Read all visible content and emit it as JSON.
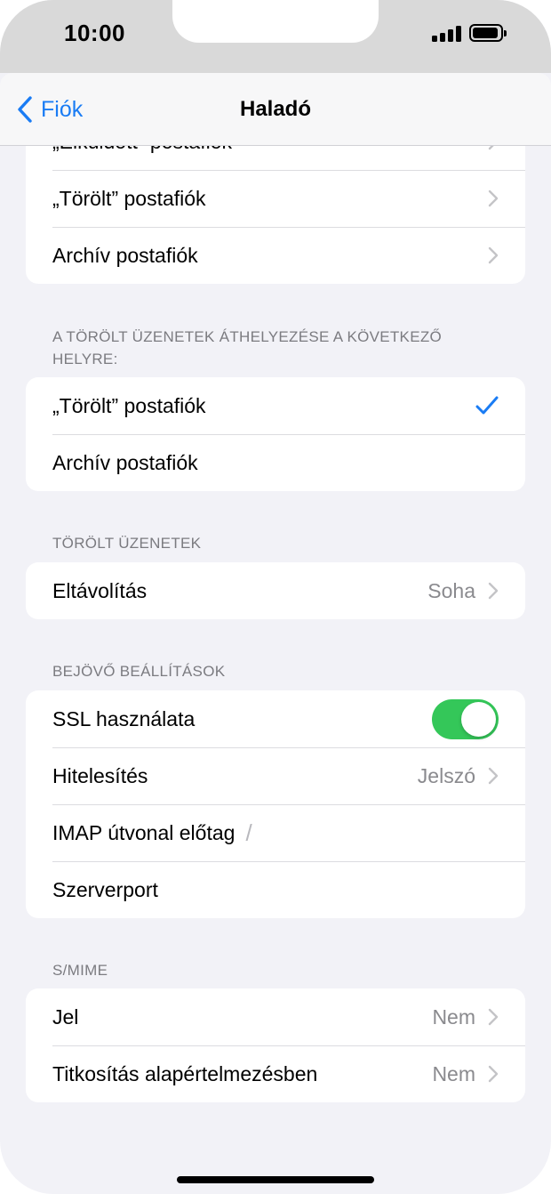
{
  "status": {
    "time": "10:00"
  },
  "nav": {
    "back_label": "Fiók",
    "title": "Haladó"
  },
  "mailbox_group": {
    "partial_label": "„Elküldött” postafiók",
    "rows": [
      {
        "label": "„Törölt” postafiók"
      },
      {
        "label": "Archív postafiók"
      }
    ]
  },
  "move_group": {
    "header": "A törölt üzenetek áthelyezése a következő helyre:",
    "rows": [
      {
        "label": "„Törölt” postafiók",
        "selected": true
      },
      {
        "label": "Archív postafiók",
        "selected": false
      }
    ]
  },
  "deleted_group": {
    "header": "Törölt üzenetek",
    "rows": [
      {
        "label": "Eltávolítás",
        "value": "Soha"
      }
    ]
  },
  "incoming_group": {
    "header": "Bejövő beállítások",
    "ssl": {
      "label": "SSL használata",
      "on": true
    },
    "auth": {
      "label": "Hitelesítés",
      "value": "Jelszó"
    },
    "imap": {
      "label": "IMAP útvonal előtag",
      "value": "/"
    },
    "port": {
      "label": "Szerverport"
    }
  },
  "smime_group": {
    "header": "S/MIME",
    "rows": [
      {
        "label": "Jel",
        "value": "Nem"
      },
      {
        "label": "Titkosítás alapértelmezésben",
        "value": "Nem"
      }
    ]
  },
  "colors": {
    "accent": "#1a7cf4",
    "toggle_on": "#34c759"
  }
}
